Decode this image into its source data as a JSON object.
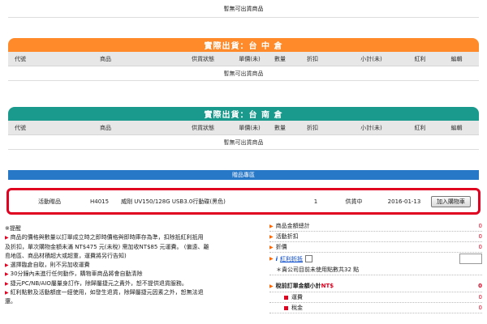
{
  "columns": [
    "代號",
    "商品",
    "供貨狀態",
    "單價(未)",
    "數量",
    "折扣",
    "小計(未)",
    "紅利",
    "編輯"
  ],
  "empty_text": "暫無可出貨商品",
  "warehouses": [
    {
      "title": "實際出貨：台 中 倉",
      "color": "#ff8a2a"
    },
    {
      "title": "實際出貨：台 南 倉",
      "color": "#1a9a8c"
    }
  ],
  "gift": {
    "header": "贈品專區",
    "type": "活動贈品",
    "code": "H4015",
    "name": "威剛 UV150/128G USB3.0行動碟(黑色)",
    "qty": "1",
    "status": "供貨中",
    "date": "2016-01-13",
    "button": "加入購物車"
  },
  "notes": {
    "title": "※提醒",
    "items": [
      "商品的價格與數量以訂單成立時之即時價格與即時庫存為準，扣除抵紅利抵用",
      "及折扣，單次購物金額未滿 NT$475 元(未稅) 需加收NT$85 元運費。 (偏遠、離",
      "島地區、商品材積超大或超重，運費將另行告知)",
      "選擇臨倉自取，則不另加收運費",
      "30分鐘內未進行任何動作，購物車商品將會自動清除",
      "捷元PC/NB/AIO屬量身訂作，除歸屬捷元之責外，恕不提供退貨服務。",
      "紅利點數及活動額度一經使用，如發生退貨，除歸屬捷元因素之外，恕無法退",
      "還。"
    ],
    "bullet_rows": [
      0,
      3,
      4,
      5,
      6
    ]
  },
  "summary": {
    "rows": [
      {
        "label": "商品金額總計",
        "value": "0"
      },
      {
        "label": "活動折扣",
        "value": "0"
      },
      {
        "label": "折價",
        "value": "0"
      }
    ],
    "bonus_label": "紅利折抵",
    "bonus_note": "＊貴公司目前未使用點數共32 點",
    "total_label": "稅前訂單金額小計",
    "total_currency": "NT$",
    "total_value": "0",
    "sub_rows": [
      {
        "label": "運費",
        "value": "0"
      },
      {
        "label": "稅金",
        "value": "0"
      }
    ]
  }
}
